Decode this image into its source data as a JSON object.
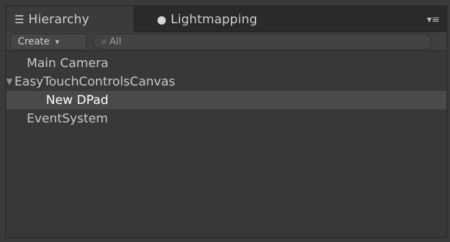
{
  "tabs": [
    {
      "label": "Hierarchy",
      "icon": "hierarchy-list-icon",
      "active": true
    },
    {
      "label": "Lightmapping",
      "icon": "lightbulb-icon",
      "active": false
    }
  ],
  "toolbar": {
    "create_label": "Create",
    "search_placeholder": "All"
  },
  "hierarchy": {
    "items": [
      {
        "label": "Main Camera",
        "level": 0,
        "expandable": false,
        "selected": false
      },
      {
        "label": "EasyTouchControlsCanvas",
        "level": 0,
        "expandable": true,
        "expanded": true,
        "selected": false
      },
      {
        "label": "New DPad",
        "level": 1,
        "expandable": false,
        "selected": true
      },
      {
        "label": "EventSystem",
        "level": 0,
        "expandable": false,
        "selected": false
      }
    ]
  },
  "colors": {
    "panel_bg": "#383838",
    "tabstrip_bg": "#2a2a2a",
    "selected_row": "#4a4a4a",
    "text": "#c8c8c8"
  }
}
